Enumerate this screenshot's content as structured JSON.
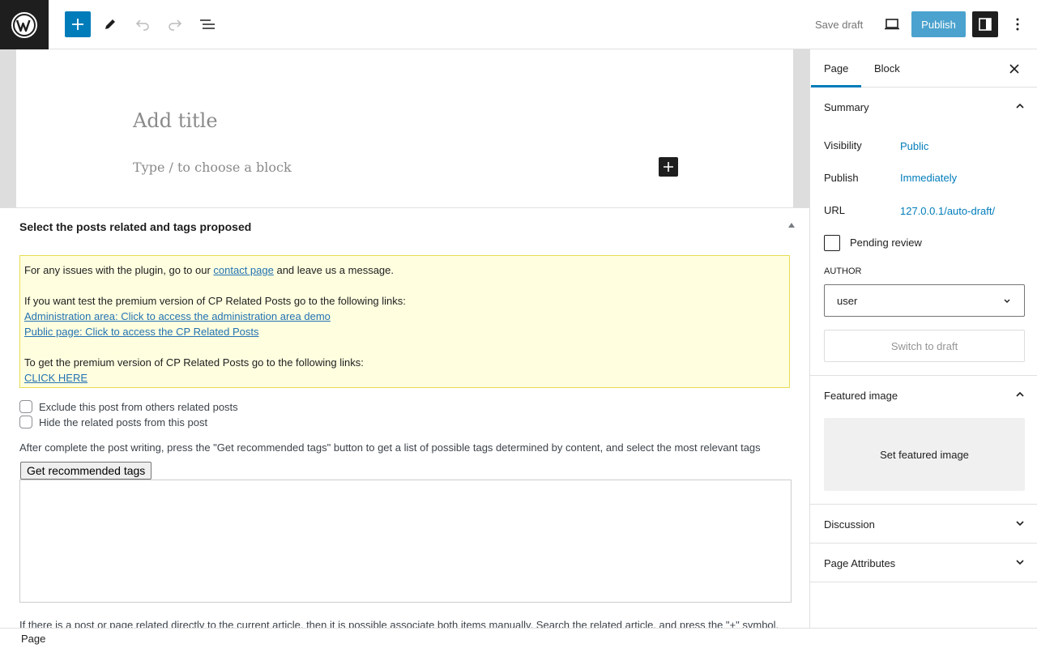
{
  "header": {
    "save_draft": "Save draft",
    "publish": "Publish",
    "icons": [
      "wordpress-logo",
      "plus-icon",
      "pencil-icon",
      "undo-icon",
      "redo-icon",
      "list-view-icon",
      "desktop-icon",
      "sidebar-icon",
      "more-vertical-icon"
    ]
  },
  "editor": {
    "title_placeholder": "Add title",
    "block_placeholder": "Type / to choose a block"
  },
  "metabox": {
    "title": "Select the posts related and tags proposed",
    "notice": {
      "line1_pre": "For any issues with the plugin, go to our ",
      "line1_link": "contact page",
      "line1_post": " and leave us a message.",
      "line2": "If you want test the premium version of CP Related Posts go to the following links:",
      "link_admin": "Administration area: Click to access the administration area demo",
      "link_public": "Public page: Click to access the CP Related Posts",
      "line3": "To get the premium version of CP Related Posts go to the following links:",
      "link_click": "CLICK HERE"
    },
    "exclude_label": "Exclude this post from others related posts",
    "hide_label": "Hide the related posts from this post",
    "help_text": "After complete the post writing, press the \"Get recommended tags\" button to get a list of possible tags determined by content, and select the most relevant tags",
    "recommend_button": "Get recommended tags",
    "footer_text": "If there is a post or page related directly to the current article, then it is possible associate both items manually. Search the related article, and press the \"+\" symbol."
  },
  "sidebar": {
    "tab_page": "Page",
    "tab_block": "Block",
    "summary": {
      "title": "Summary",
      "visibility_label": "Visibility",
      "visibility_value": "Public",
      "publish_label": "Publish",
      "publish_value": "Immediately",
      "url_label": "URL",
      "url_value": "127.0.0.1/auto-draft/",
      "pending_label": "Pending review",
      "author_label": "AUTHOR",
      "author_value": "user",
      "switch_draft": "Switch to draft"
    },
    "featured": {
      "title": "Featured image",
      "set_button": "Set featured image"
    },
    "discussion": "Discussion",
    "page_attributes": "Page Attributes"
  },
  "status": {
    "breadcrumb": "Page"
  },
  "colors": {
    "accent": "#007cba",
    "notice_bg": "#ffffe0",
    "notice_border": "#e6db55"
  }
}
